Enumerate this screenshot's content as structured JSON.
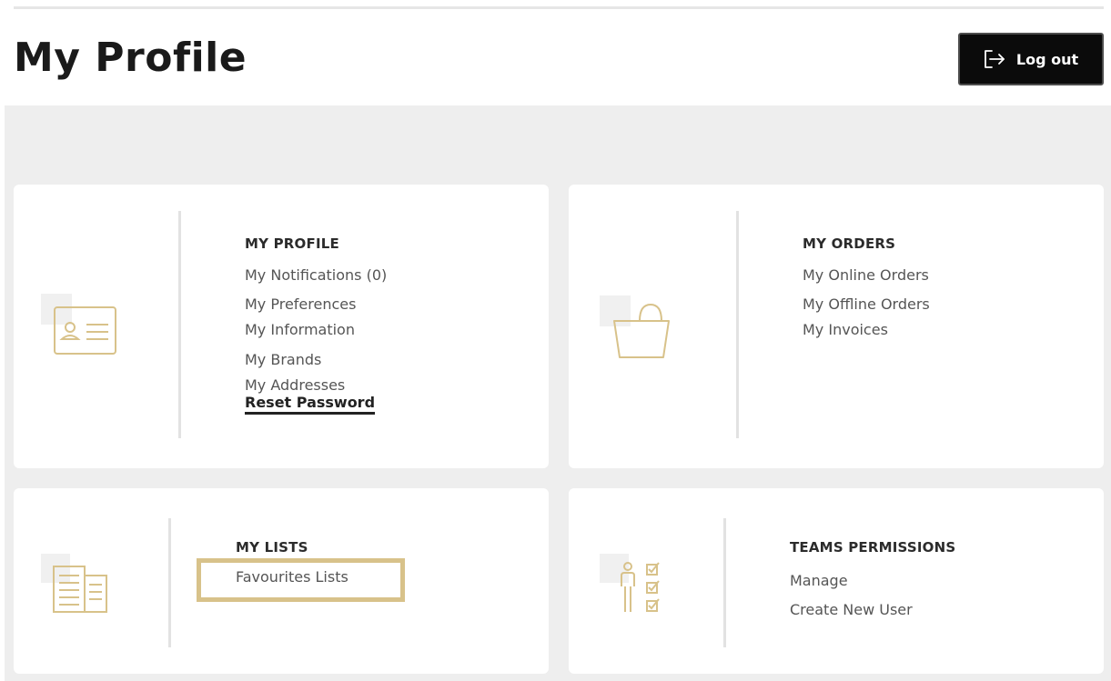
{
  "page": {
    "title": "My Profile"
  },
  "header": {
    "logout_label": "Log out"
  },
  "icons": {
    "accent": "#d8c28a",
    "shadow": "#f0f0f0"
  },
  "cards": {
    "profile": {
      "title": "MY PROFILE",
      "links": [
        "My Notifications (0)",
        "My Preferences",
        "My Information",
        "My Brands",
        "My Addresses",
        "Reset Password"
      ]
    },
    "orders": {
      "title": "MY ORDERS",
      "links": [
        "My Online Orders",
        "My Offline Orders",
        "My Invoices"
      ]
    },
    "lists": {
      "title": "MY LISTS",
      "links": [
        "Favourites Lists"
      ]
    },
    "teams": {
      "title": "TEAMS PERMISSIONS",
      "links": [
        "Manage",
        "Create New User"
      ]
    }
  }
}
